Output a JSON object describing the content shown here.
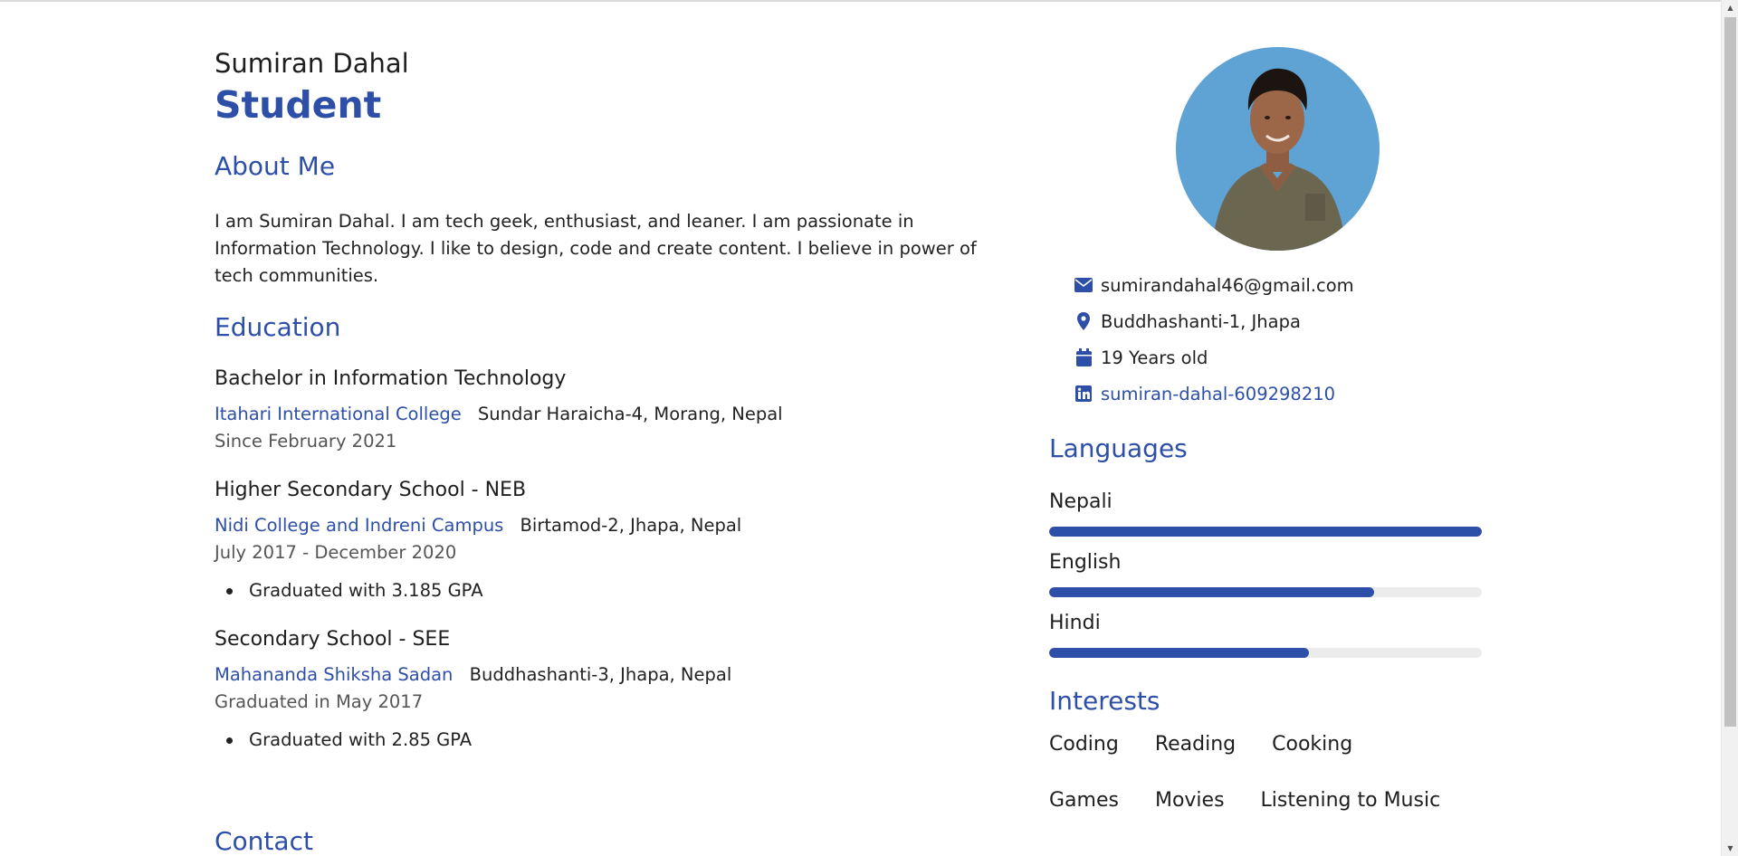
{
  "profile": {
    "name": "Sumiran Dahal",
    "role": "Student"
  },
  "about": {
    "title": "About Me",
    "text": "I am Sumiran Dahal. I am tech geek, enthusiast, and leaner. I am passionate in Information Technology. I like to design, code and create content. I believe in power of tech communities."
  },
  "education": {
    "title": "Education",
    "items": [
      {
        "degree": "Bachelor in Information Technology",
        "school": "Itahari International College",
        "place": "Sundar Haraicha-4, Morang, Nepal",
        "date": "Since February 2021",
        "bullets": []
      },
      {
        "degree": "Higher Secondary School - NEB",
        "school": "Nidi College and Indreni Campus",
        "place": "Birtamod-2, Jhapa, Nepal",
        "date": "July 2017 - December 2020",
        "bullets": [
          "Graduated with 3.185 GPA"
        ]
      },
      {
        "degree": "Secondary School - SEE",
        "school": "Mahananda Shiksha Sadan",
        "place": "Buddhashanti-3, Jhapa, Nepal",
        "date": "Graduated in May 2017",
        "bullets": [
          "Graduated with 2.85 GPA"
        ]
      }
    ]
  },
  "contact_section": {
    "title": "Contact"
  },
  "contact": {
    "email": "sumirandahal46@gmail.com",
    "location": "Buddhashanti-1, Jhapa",
    "age": "19 Years old",
    "linkedin": "sumiran-dahal-609298210"
  },
  "languages": {
    "title": "Languages",
    "items": [
      {
        "name": "Nepali",
        "level": 1.0
      },
      {
        "name": "English",
        "level": 0.75
      },
      {
        "name": "Hindi",
        "level": 0.6
      }
    ]
  },
  "interests": {
    "title": "Interests",
    "items": [
      "Coding",
      "Reading",
      "Cooking",
      "Games",
      "Movies",
      "Listening to Music"
    ]
  },
  "colors": {
    "accent": "#2d4fa8",
    "avatar_bg": "#5ea3d4",
    "bar_track": "#ececec"
  },
  "icons": {
    "email": "envelope-icon",
    "location": "map-pin-icon",
    "age": "calendar-icon",
    "linkedin": "linkedin-icon"
  }
}
